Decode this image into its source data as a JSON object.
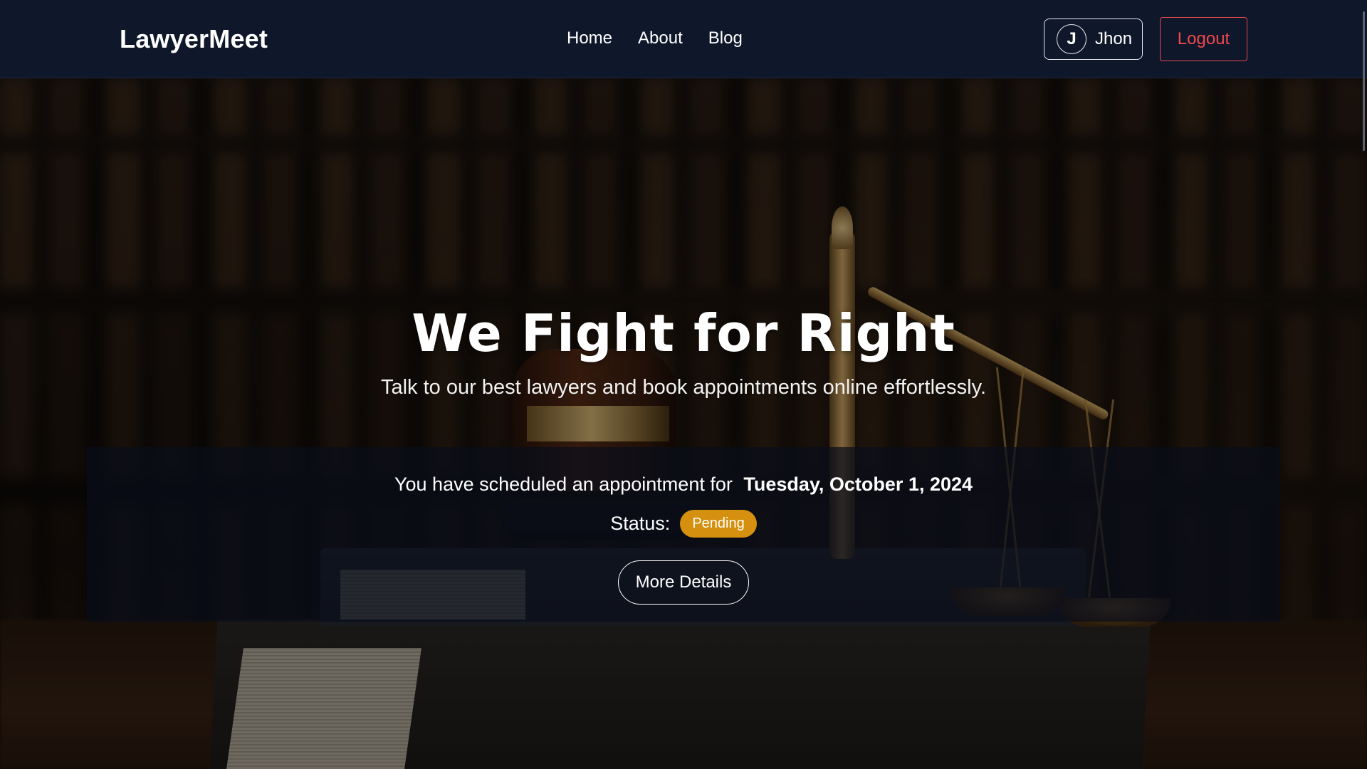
{
  "header": {
    "brand": "LawyerMeet",
    "nav": [
      {
        "label": "Home"
      },
      {
        "label": "About"
      },
      {
        "label": "Blog"
      }
    ],
    "user": {
      "initial": "J",
      "name": "Jhon"
    },
    "logout_label": "Logout"
  },
  "hero": {
    "title": "We Fight for Right",
    "subtitle": "Talk to our best lawyers and book appointments online effortlessly."
  },
  "appointment": {
    "message": "You have scheduled an appointment for",
    "date": "Tuesday, October 1, 2024",
    "status_label": "Status:",
    "status_value": "Pending",
    "details_label": "More Details"
  },
  "colors": {
    "navbar_bg": "#0f172a",
    "logout_red": "#e5484d",
    "status_badge": "#d4900e"
  }
}
